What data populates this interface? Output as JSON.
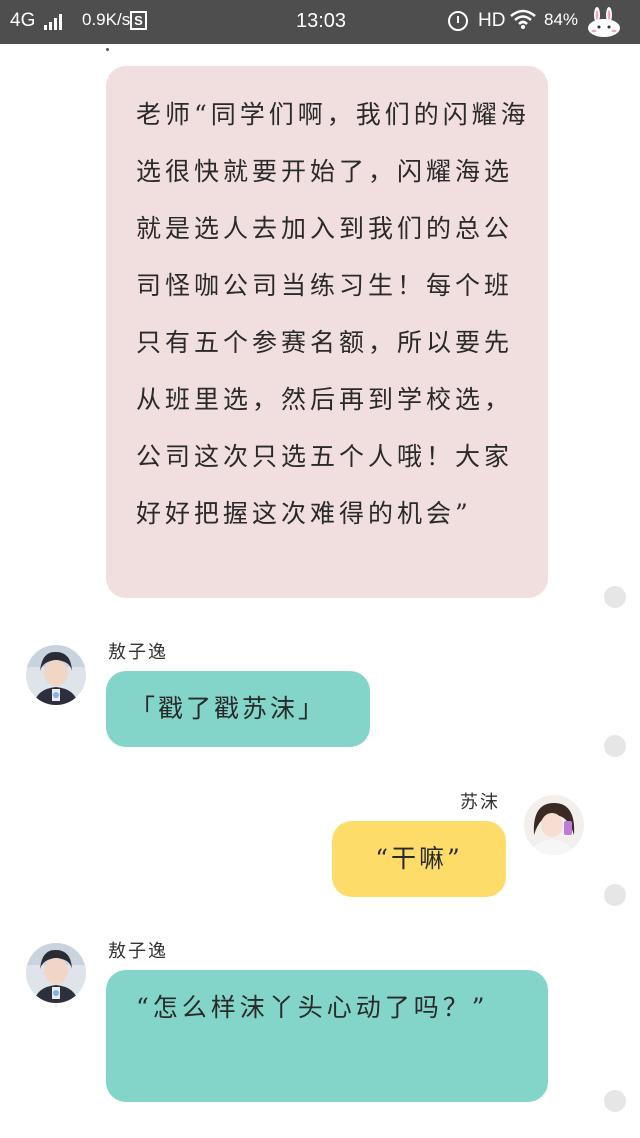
{
  "status_bar": {
    "network": "4G",
    "speed": "0.9K/s",
    "s_badge": "S",
    "time": "13:03",
    "hd": "HD",
    "battery": "84%"
  },
  "messages": [
    {
      "sender": "",
      "side": "left",
      "color": "#f1dede",
      "text": "老师“同学们啊，我们的闪耀海选很快就要开始了，闪耀海选就是选人去加入到我们的总公司怪咖公司当练习生！每个班只有五个参赛名额，所以要先从班里选，然后再到学校选，公司这次只选五个人哦！大家好好把握这次难得的机会”"
    },
    {
      "sender": "敖子逸",
      "side": "left",
      "color": "#82d5c8",
      "text": "「戳了戳苏沫」"
    },
    {
      "sender": "苏沫",
      "side": "right",
      "color": "#fddc6a",
      "text": "“干嘛”"
    },
    {
      "sender": "敖子逸",
      "side": "left",
      "color": "#82d5c8",
      "text": "“怎么样沫丫头心动了吗？”"
    }
  ],
  "icons": {
    "signal": "signal-bars-icon",
    "alarm": "alarm-icon",
    "wifi": "wifi-icon",
    "mascot": "bunny-icon",
    "read_dot": "read-status-dot-icon"
  }
}
